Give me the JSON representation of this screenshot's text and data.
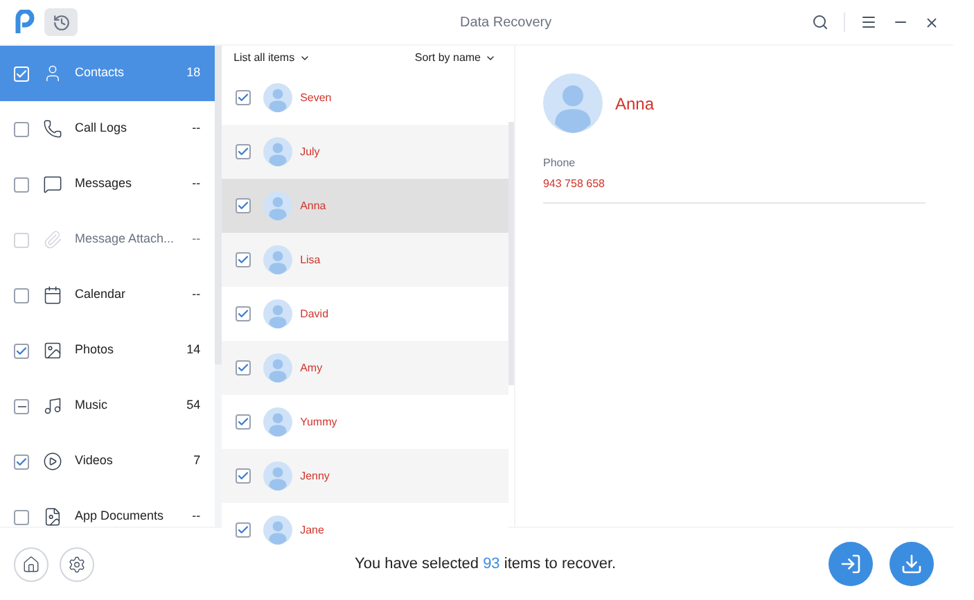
{
  "window": {
    "title": "Data Recovery"
  },
  "sidebar": {
    "items": [
      {
        "label": "Contacts",
        "count": "18",
        "checked": true,
        "partial": false,
        "selected": true,
        "disabled": false
      },
      {
        "label": "Call Logs",
        "count": "--",
        "checked": false,
        "partial": false,
        "selected": false,
        "disabled": false
      },
      {
        "label": "Messages",
        "count": "--",
        "checked": false,
        "partial": false,
        "selected": false,
        "disabled": false
      },
      {
        "label": "Message Attach...",
        "count": "--",
        "checked": false,
        "partial": false,
        "selected": false,
        "disabled": true
      },
      {
        "label": "Calendar",
        "count": "--",
        "checked": false,
        "partial": false,
        "selected": false,
        "disabled": false
      },
      {
        "label": "Photos",
        "count": "14",
        "checked": true,
        "partial": false,
        "selected": false,
        "disabled": false
      },
      {
        "label": "Music",
        "count": "54",
        "checked": false,
        "partial": true,
        "selected": false,
        "disabled": false
      },
      {
        "label": "Videos",
        "count": "7",
        "checked": true,
        "partial": false,
        "selected": false,
        "disabled": false
      },
      {
        "label": "App Documents",
        "count": "--",
        "checked": false,
        "partial": false,
        "selected": false,
        "disabled": false
      }
    ]
  },
  "list": {
    "filter": "List all items",
    "sort": "Sort by name",
    "contacts": [
      {
        "name": "Seven",
        "checked": true,
        "selected": false
      },
      {
        "name": "July",
        "checked": true,
        "selected": false
      },
      {
        "name": "Anna",
        "checked": true,
        "selected": true
      },
      {
        "name": "Lisa",
        "checked": true,
        "selected": false
      },
      {
        "name": "David",
        "checked": true,
        "selected": false
      },
      {
        "name": "Amy",
        "checked": true,
        "selected": false
      },
      {
        "name": "Yummy",
        "checked": true,
        "selected": false
      },
      {
        "name": "Jenny",
        "checked": true,
        "selected": false
      },
      {
        "name": "Jane",
        "checked": true,
        "selected": false
      }
    ]
  },
  "detail": {
    "name": "Anna",
    "field_label": "Phone",
    "field_value": "943 758 658"
  },
  "footer": {
    "before": "You have selected",
    "count": "93",
    "after": "items to recover."
  }
}
